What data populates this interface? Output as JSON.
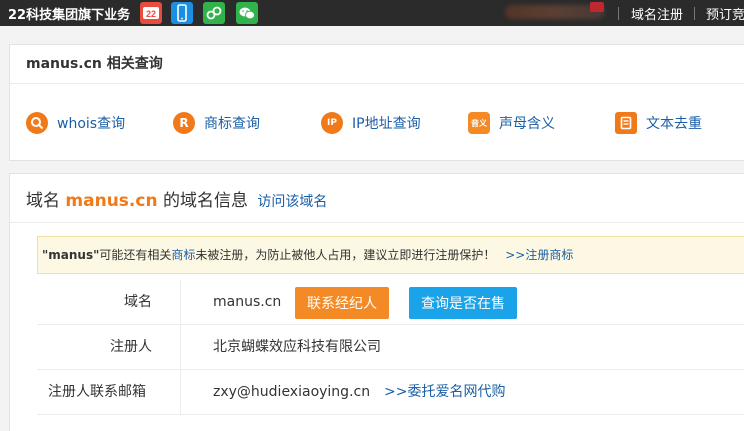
{
  "topbar": {
    "brand": "22科技集团旗下业务",
    "apps": [
      "22-app-icon",
      "phone-app-icon",
      "link-app-icon",
      "wechat-icon"
    ],
    "links": [
      "域名注册",
      "预订竞"
    ]
  },
  "related": {
    "title": "manus.cn 相关查询",
    "tools": [
      {
        "icon": "search-icon",
        "glyph": "Q",
        "label": "whois查询"
      },
      {
        "icon": "trademark-icon",
        "glyph": "R",
        "label": "商标查询"
      },
      {
        "icon": "ip-icon",
        "glyph": "IP",
        "label": "IP地址查询"
      },
      {
        "icon": "pinyin-icon",
        "glyph": "音义",
        "label": "声母含义"
      },
      {
        "icon": "document-icon",
        "glyph": "",
        "label": "文本去重"
      }
    ]
  },
  "info": {
    "title_prefix": "域名 ",
    "domain": "manus.cn",
    "title_suffix": " 的域名信息",
    "visit_label": "访问该域名",
    "alert": {
      "keyword": "\"manus\"",
      "text_before": "可能还有相关",
      "trademark_link": "商标",
      "text_after": "未被注册，为防止被他人占用，建议立即进行注册保护！",
      "register_link": ">>注册商标"
    },
    "rows": [
      {
        "label": "域名",
        "value": "manus.cn",
        "button1": "联系经纪人",
        "button2": "查询是否在售"
      },
      {
        "label": "注册人",
        "value": "北京蝴蝶效应科技有限公司"
      },
      {
        "label": "注册人联系邮箱",
        "value": "zxy@hudiexiaoying.cn",
        "link": ">>委托爱名网代购"
      }
    ]
  },
  "colors": {
    "accent": "#f07a1a",
    "link": "#1b5fa6",
    "topbar": "#2b2b2b",
    "blue_button": "#1aa3e8"
  }
}
